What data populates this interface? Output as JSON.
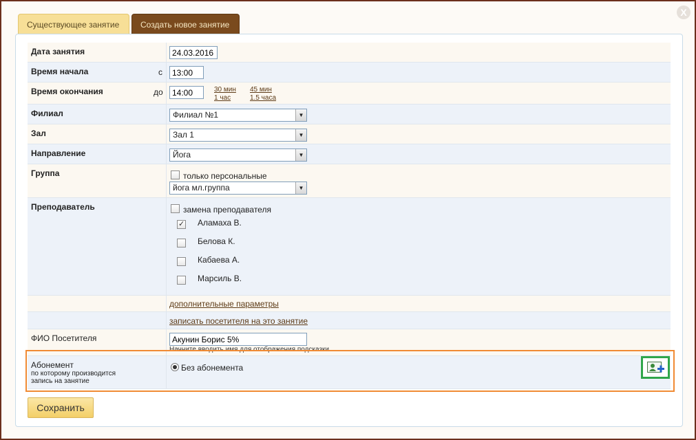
{
  "close_label": "X",
  "tabs": [
    {
      "label": "Существующее занятие",
      "active": false
    },
    {
      "label": "Создать новое занятие",
      "active": true
    }
  ],
  "form": {
    "date": {
      "label": "Дата занятия",
      "value": "24.03.2016"
    },
    "start": {
      "label": "Время начала",
      "prefix": "с",
      "value": "13:00"
    },
    "end": {
      "label": "Время окончания",
      "prefix": "до",
      "value": "14:00",
      "quick_links": [
        "30 мин",
        "1 час",
        "45 мин",
        "1.5 часа"
      ]
    },
    "branch": {
      "label": "Филиал",
      "value": "Филиал №1"
    },
    "hall": {
      "label": "Зал",
      "value": "Зал 1"
    },
    "direction": {
      "label": "Направление",
      "value": "Йога"
    },
    "group": {
      "label": "Группа",
      "checkbox_label": "только персональные",
      "checkbox_checked": false,
      "value": "йога мл.группа"
    },
    "teacher": {
      "label": "Преподаватель",
      "replace_label": "замена преподавателя",
      "replace_checked": false,
      "teachers": [
        {
          "name": "Аламаха В.",
          "checked": true
        },
        {
          "name": "Белова К.",
          "checked": false
        },
        {
          "name": "Кабаева А.",
          "checked": false
        },
        {
          "name": "Марсиль В.",
          "checked": false
        }
      ]
    },
    "extra_params_link": "дополнительные параметры",
    "register_visitor_link": "записать посетителя на это занятие",
    "visitor": {
      "label": "ФИО Посетителя",
      "value": "Акунин Борис 5%",
      "hint": "Начните вводить имя для отображения подсказки"
    },
    "subscription": {
      "label_line1": "Абонемент",
      "label_line2": "по которому производится",
      "label_line3": "запись на занятие",
      "option": "Без абонемента"
    }
  },
  "save_label": "Сохранить",
  "colors": {
    "highlight_box": "#f08a33",
    "add_button_border": "#2fa64a",
    "active_tab": "#7a4a1d"
  },
  "icons": {
    "add_client": "add-user-icon"
  }
}
